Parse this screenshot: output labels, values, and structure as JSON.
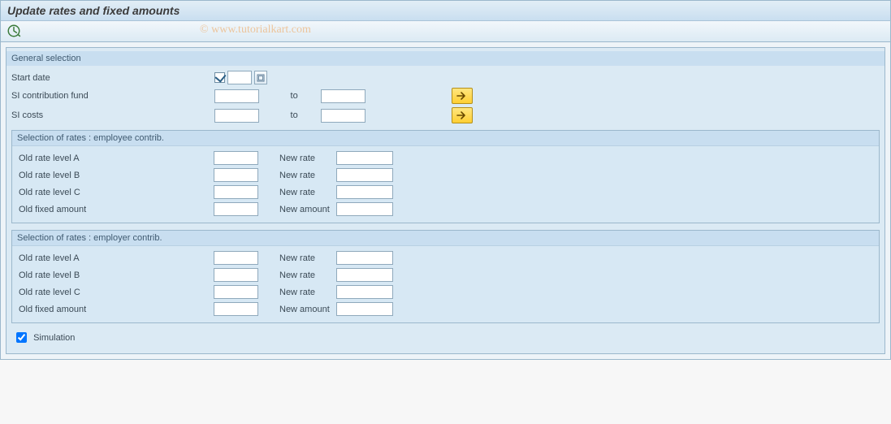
{
  "title": "Update rates and fixed amounts",
  "watermark": "© www.tutorialkart.com",
  "general": {
    "header": "General selection",
    "start_date_label": "Start date",
    "start_date_value": "",
    "fund_label": "SI contribution fund",
    "fund_from": "",
    "fund_to_label": "to",
    "fund_to": "",
    "costs_label": "SI costs",
    "costs_from": "",
    "costs_to_label": "to",
    "costs_to": ""
  },
  "employee": {
    "header": "Selection of rates : employee contrib.",
    "rows": [
      {
        "old_label": "Old rate level A",
        "old_value": "",
        "new_label": "New rate",
        "new_value": ""
      },
      {
        "old_label": "Old rate level B",
        "old_value": "",
        "new_label": "New rate",
        "new_value": ""
      },
      {
        "old_label": "Old rate level C",
        "old_value": "",
        "new_label": "New rate",
        "new_value": ""
      },
      {
        "old_label": "Old fixed amount",
        "old_value": "",
        "new_label": "New amount",
        "new_value": ""
      }
    ]
  },
  "employer": {
    "header": "Selection of rates : employer contrib.",
    "rows": [
      {
        "old_label": "Old rate level A",
        "old_value": "",
        "new_label": "New rate",
        "new_value": ""
      },
      {
        "old_label": "Old rate level B",
        "old_value": "",
        "new_label": "New rate",
        "new_value": ""
      },
      {
        "old_label": "Old rate level C",
        "old_value": "",
        "new_label": "New rate",
        "new_value": ""
      },
      {
        "old_label": "Old fixed amount",
        "old_value": "",
        "new_label": "New amount",
        "new_value": ""
      }
    ]
  },
  "simulation": {
    "label": "Simulation",
    "checked": true
  }
}
